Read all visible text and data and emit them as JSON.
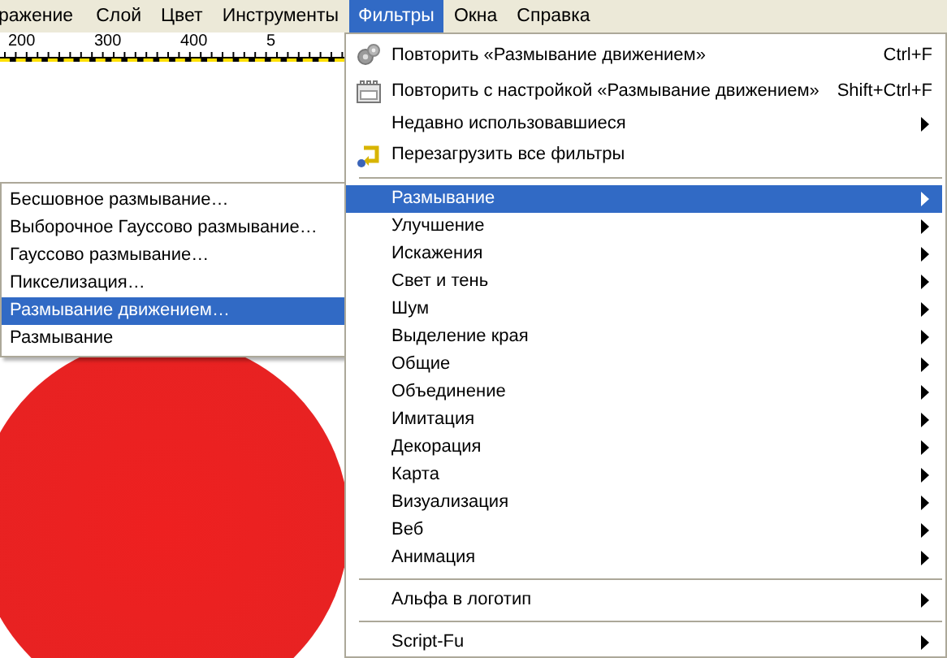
{
  "menu_bar": {
    "items": [
      {
        "label": "ражение",
        "selected": false
      },
      {
        "label": "Слой",
        "selected": false
      },
      {
        "label": "Цвет",
        "selected": false
      },
      {
        "label": "Инструменты",
        "selected": false
      },
      {
        "label": "Фильтры",
        "selected": true
      },
      {
        "label": "Окна",
        "selected": false
      },
      {
        "label": "Справка",
        "selected": false
      }
    ]
  },
  "ruler": {
    "labels": [
      "200",
      "300",
      "400",
      "5"
    ]
  },
  "filters_menu": {
    "items": [
      {
        "kind": "repeat",
        "label": "Повторить «Размывание движением»",
        "shortcut": "Ctrl+F"
      },
      {
        "kind": "reshow",
        "label": "Повторить с настройкой «Размывание движением»",
        "shortcut": "Shift+Ctrl+F"
      },
      {
        "kind": "submenu",
        "label": "Недавно использовавшиеся",
        "selected": false
      },
      {
        "kind": "reload",
        "label": "Перезагрузить все фильтры"
      },
      {
        "kind": "separator"
      },
      {
        "kind": "submenu",
        "label": "Размывание",
        "selected": true
      },
      {
        "kind": "submenu",
        "label": "Улучшение",
        "selected": false
      },
      {
        "kind": "submenu",
        "label": "Искажения",
        "selected": false
      },
      {
        "kind": "submenu",
        "label": "Свет и тень",
        "selected": false
      },
      {
        "kind": "submenu",
        "label": "Шум",
        "selected": false
      },
      {
        "kind": "submenu",
        "label": "Выделение края",
        "selected": false
      },
      {
        "kind": "submenu",
        "label": "Общие",
        "selected": false
      },
      {
        "kind": "submenu",
        "label": "Объединение",
        "selected": false
      },
      {
        "kind": "submenu",
        "label": "Имитация",
        "selected": false
      },
      {
        "kind": "submenu",
        "label": "Декорация",
        "selected": false
      },
      {
        "kind": "submenu",
        "label": "Карта",
        "selected": false
      },
      {
        "kind": "submenu",
        "label": "Визуализация",
        "selected": false
      },
      {
        "kind": "submenu",
        "label": "Веб",
        "selected": false
      },
      {
        "kind": "submenu",
        "label": "Анимация",
        "selected": false
      },
      {
        "kind": "separator"
      },
      {
        "kind": "submenu",
        "label": "Альфа в логотип",
        "selected": false
      },
      {
        "kind": "separator"
      },
      {
        "kind": "submenu",
        "label": "Script-Fu",
        "selected": false
      }
    ]
  },
  "blur_submenu": {
    "items": [
      {
        "label": "Бесшовное размывание…",
        "selected": false
      },
      {
        "label": "Выборочное Гауссово размывание…",
        "selected": false
      },
      {
        "label": "Гауссово размывание…",
        "selected": false
      },
      {
        "label": "Пикселизация…",
        "selected": false
      },
      {
        "label": "Размывание движением…",
        "selected": true
      },
      {
        "label": "Размывание",
        "selected": false
      }
    ]
  }
}
